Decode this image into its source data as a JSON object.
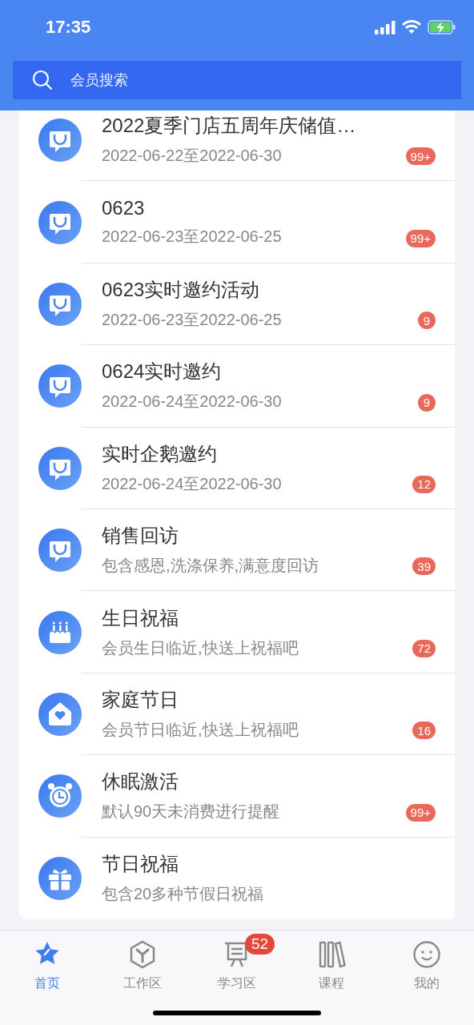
{
  "status_bar": {
    "time": "17:35"
  },
  "search": {
    "placeholder": "会员搜索"
  },
  "items": [
    {
      "kind": "bag",
      "title": "2022夏季门店五周年庆储值…",
      "subtitle": "2022-06-22至2022-06-30",
      "badge": "99+"
    },
    {
      "kind": "bag",
      "title": "0623",
      "subtitle": "2022-06-23至2022-06-25",
      "badge": "99+"
    },
    {
      "kind": "bag",
      "title": "0623实时邀约活动",
      "subtitle": "2022-06-23至2022-06-25",
      "badge": "9"
    },
    {
      "kind": "bag",
      "title": "0624实时邀约",
      "subtitle": "2022-06-24至2022-06-30",
      "badge": "9"
    },
    {
      "kind": "bag",
      "title": "实时企鹅邀约",
      "subtitle": "2022-06-24至2022-06-30",
      "badge": "12"
    },
    {
      "kind": "bag",
      "title": "销售回访",
      "subtitle": "包含感恩,洗涤保养,满意度回访",
      "badge": "39"
    },
    {
      "kind": "cake",
      "title": "生日祝福",
      "subtitle": "会员生日临近,快送上祝福吧",
      "badge": "72"
    },
    {
      "kind": "house",
      "title": "家庭节日",
      "subtitle": "会员节日临近,快送上祝福吧",
      "badge": "16"
    },
    {
      "kind": "clock",
      "title": "休眠激活",
      "subtitle": "默认90天未消费进行提醒",
      "badge": "99+"
    },
    {
      "kind": "gift",
      "title": "节日祝福",
      "subtitle": "包含20多种节假日祝福"
    }
  ],
  "tabs": [
    {
      "kind": "star",
      "label": "首页",
      "selected": true
    },
    {
      "kind": "hexagon",
      "label": "工作区",
      "selected": false
    },
    {
      "kind": "board",
      "label": "学习区",
      "selected": false,
      "badge": "52"
    },
    {
      "kind": "books",
      "label": "课程",
      "selected": false
    },
    {
      "kind": "smiley",
      "label": "我的",
      "selected": false
    }
  ]
}
